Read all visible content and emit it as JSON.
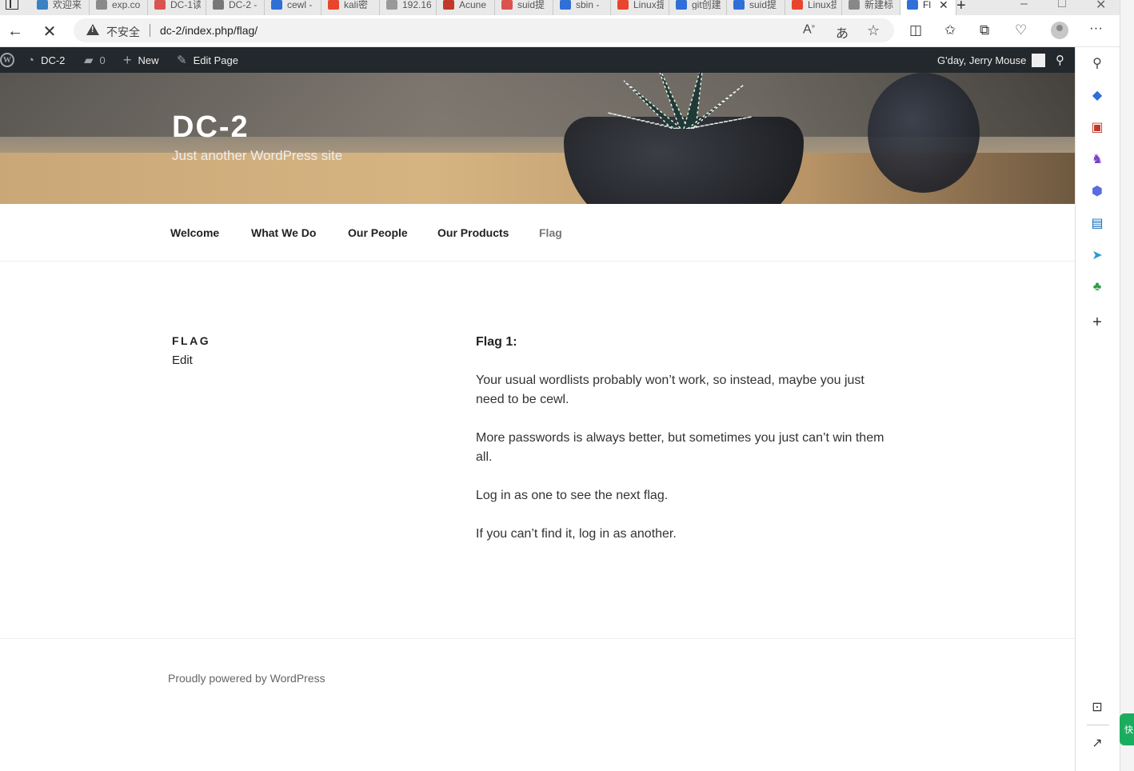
{
  "browser": {
    "tabs": [
      {
        "label": "欢迎来",
        "color": "#3b82c4"
      },
      {
        "label": "exp.co",
        "color": "#8a8a8a"
      },
      {
        "label": "DC-1读",
        "color": "#d9534f"
      },
      {
        "label": "DC-2 -",
        "color": "#777777"
      },
      {
        "label": "cewl -",
        "color": "#2f6fd6"
      },
      {
        "label": "kali密",
        "color": "#e8452c"
      },
      {
        "label": "192.16",
        "color": "#999999"
      },
      {
        "label": "Acune",
        "color": "#c0392b"
      },
      {
        "label": "suid提",
        "color": "#d9534f"
      },
      {
        "label": "sbin -",
        "color": "#2f6fd6"
      },
      {
        "label": "Linux提",
        "color": "#e8452c"
      },
      {
        "label": "git创建",
        "color": "#2f6fd6"
      },
      {
        "label": "suid提",
        "color": "#2f6fd6"
      },
      {
        "label": "Linux提",
        "color": "#e8452c"
      },
      {
        "label": "新建标",
        "color": "#888888"
      },
      {
        "label": "Fl",
        "color": "#2f6fd6",
        "active": true
      }
    ],
    "insecure_label": "不安全",
    "url": "dc-2/index.php/flag/"
  },
  "adminbar": {
    "site": "DC-2",
    "comments": "0",
    "new": "New",
    "edit_page": "Edit Page",
    "greeting": "G'day, Jerry Mouse"
  },
  "header": {
    "title": "DC-2",
    "tagline": "Just another WordPress site"
  },
  "menu": {
    "items": [
      "Welcome",
      "What We Do",
      "Our People",
      "Our Products",
      "Flag"
    ]
  },
  "page": {
    "title": "FLAG",
    "edit": "Edit",
    "paragraphs": [
      "Flag 1:",
      "Your usual wordlists probably won’t work, so instead, maybe you just need to be cewl.",
      "More passwords is always better, but sometimes you just can’t win them all.",
      "Log in as one to see the next flag.",
      "If you can’t find it, log in as another."
    ]
  },
  "footer": {
    "powered": "Proudly powered by WordPress"
  },
  "sidebar": {
    "green_tab": "快"
  }
}
